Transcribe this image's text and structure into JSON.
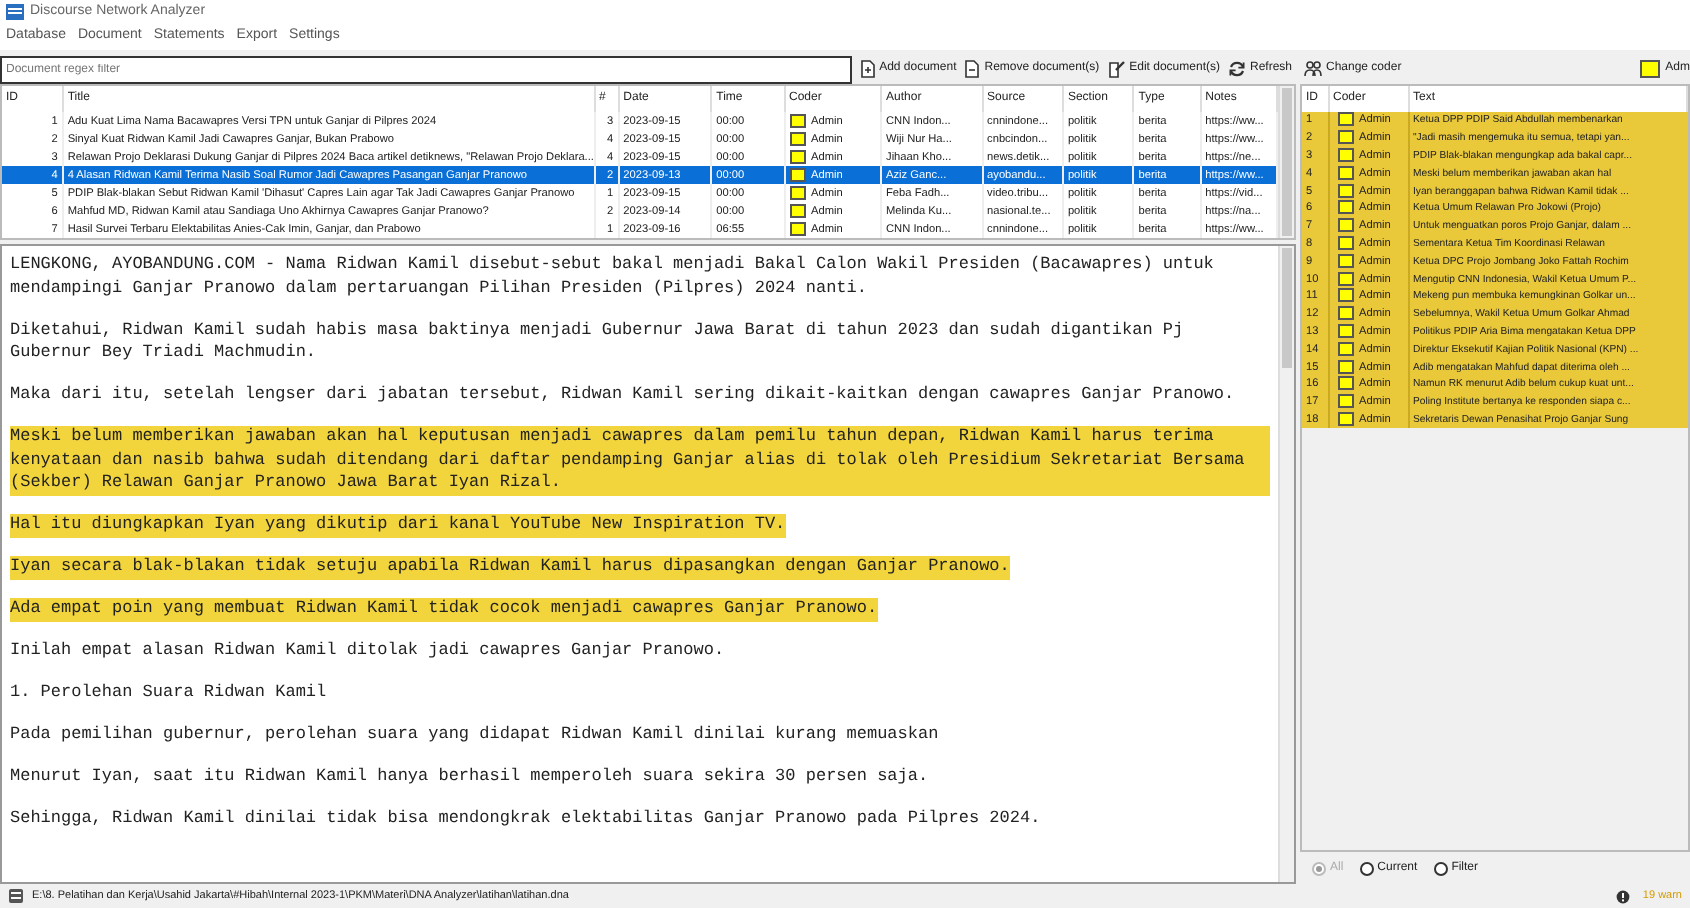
{
  "window": {
    "title": "Discourse Network Analyzer"
  },
  "menu": [
    "Database",
    "Document",
    "Statements",
    "Export",
    "Settings"
  ],
  "filter": {
    "placeholder": "Document regex filter"
  },
  "toolbar": [
    "Add document",
    "Remove document(s)",
    "Edit document(s)",
    "Refresh"
  ],
  "documents": {
    "columns": [
      "ID",
      "Title",
      "#",
      "Date",
      "Time",
      "Coder",
      "Author",
      "Source",
      "Section",
      "Type",
      "Notes"
    ],
    "rows": [
      {
        "id": "1",
        "title": "Adu Kuat Lima Nama Bacawapres Versi TPN untuk Ganjar di Pilpres 2024",
        "count": "3",
        "date": "2023-09-15",
        "time": "00:00",
        "coder": "Admin",
        "color": "#ffff00",
        "author": "CNN Indon...",
        "source": "cnnindone...",
        "section": "politik",
        "type": "berita",
        "notes": "https://ww...",
        "selected": false
      },
      {
        "id": "2",
        "title": "Sinyal Kuat Ridwan Kamil Jadi Cawapres Ganjar, Bukan Prabowo",
        "count": "4",
        "date": "2023-09-15",
        "time": "00:00",
        "coder": "Admin",
        "color": "#ffff00",
        "author": "Wiji Nur Ha...",
        "source": "cnbcindon...",
        "section": "politik",
        "type": "berita",
        "notes": "https://ww...",
        "selected": false
      },
      {
        "id": "3",
        "title": "Relawan Projo Deklarasi Dukung Ganjar di Pilpres 2024  Baca artikel detiknews, \"Relawan Projo Deklara...",
        "count": "4",
        "date": "2023-09-15",
        "time": "00:00",
        "coder": "Admin",
        "color": "#ffff00",
        "author": "Jihaan Kho...",
        "source": "news.detik...",
        "section": "politik",
        "type": "berita",
        "notes": "https://ne...",
        "selected": false
      },
      {
        "id": "4",
        "title": "4 Alasan Ridwan Kamil Terima Nasib Soal Rumor Jadi Cawapres Pasangan Ganjar Pranowo",
        "count": "2",
        "date": "2023-09-13",
        "time": "00:00",
        "coder": "Admin",
        "color": "#ffff00",
        "author": "Aziz Ganc...",
        "source": "ayobandu...",
        "section": "politik",
        "type": "berita",
        "notes": "https://ww...",
        "selected": true
      },
      {
        "id": "5",
        "title": "PDIP Blak-blakan Sebut Ridwan Kamil 'Dihasut' Capres Lain agar Tak Jadi Cawapres Ganjar Pranowo",
        "count": "1",
        "date": "2023-09-15",
        "time": "00:00",
        "coder": "Admin",
        "color": "#ffff00",
        "author": "Feba Fadh...",
        "source": "video.tribu...",
        "section": "politik",
        "type": "berita",
        "notes": "https://vid...",
        "selected": false
      },
      {
        "id": "6",
        "title": "Mahfud MD, Ridwan Kamil atau Sandiaga Uno Akhirnya Cawapres Ganjar Pranowo?",
        "count": "2",
        "date": "2023-09-14",
        "time": "00:00",
        "coder": "Admin",
        "color": "#ffff00",
        "author": "Melinda Ku...",
        "source": "nasional.te...",
        "section": "politik",
        "type": "berita",
        "notes": "https://na...",
        "selected": false
      },
      {
        "id": "7",
        "title": "Hasil Survei Terbaru Elektabilitas Anies-Cak Imin, Ganjar, dan Prabowo",
        "count": "1",
        "date": "2023-09-16",
        "time": "06:55",
        "coder": "Admin",
        "color": "#ffff00",
        "author": "CNN Indon...",
        "source": "cnnindone...",
        "section": "politik",
        "type": "berita",
        "notes": "https://ww...",
        "selected": false
      }
    ]
  },
  "document_text": [
    {
      "text": "LENGKONG, AYOBANDUNG.COM - Nama Ridwan Kamil disebut-sebut bakal menjadi Bakal Calon Wakil Presiden (Bacawapres) untuk mendampingi Ganjar Pranowo dalam pertaruangan Pilihan Presiden (Pilpres) 2024 nanti.",
      "highlighted": false
    },
    {
      "text": "Diketahui, Ridwan Kamil sudah habis masa baktinya menjadi Gubernur Jawa Barat di tahun 2023 dan sudah digantikan Pj Gubernur Bey Triadi Machmudin.",
      "highlighted": false
    },
    {
      "text": "Maka dari itu, setelah lengser dari jabatan tersebut, Ridwan Kamil sering dikait-kaitkan dengan cawapres Ganjar Pranowo.",
      "highlighted": false
    },
    {
      "text": "Meski belum memberikan jawaban akan hal keputusan menjadi cawapres dalam pemilu tahun depan, Ridwan Kamil harus terima kenyataan dan nasib bahwa sudah ditendang dari daftar pendamping Ganjar alias di tolak oleh Presidium Sekretariat Bersama (Sekber) Relawan Ganjar Pranowo Jawa Barat Iyan Rizal.",
      "highlighted": true
    },
    {
      "text": "Hal itu diungkapkan Iyan yang dikutip dari kanal YouTube New Inspiration TV.",
      "highlighted": true
    },
    {
      "text": "Iyan secara blak-blakan tidak setuju apabila Ridwan Kamil harus dipasangkan dengan Ganjar Pranowo.",
      "highlighted": true
    },
    {
      "text": "Ada empat poin yang membuat Ridwan Kamil tidak cocok menjadi cawapres Ganjar Pranowo.",
      "highlighted": true
    },
    {
      "text": "Inilah empat alasan Ridwan Kamil ditolak jadi cawapres Ganjar Pranowo.",
      "highlighted": false
    },
    {
      "text": "1. Perolehan Suara Ridwan Kamil",
      "highlighted": false
    },
    {
      "text": "Pada pemilihan gubernur, perolehan suara yang didapat Ridwan Kamil dinilai kurang memuaskan",
      "highlighted": false
    },
    {
      "text": "Menurut Iyan, saat itu Ridwan Kamil hanya berhasil memperoleh suara sekira 30 persen saja.",
      "highlighted": false
    },
    {
      "text": "Sehingga, Ridwan Kamil dinilai tidak bisa mendongkrak elektabilitas Ganjar Pranowo pada Pilpres 2024.",
      "highlighted": false
    }
  ],
  "statements_toolbar": {
    "button": "Change coder",
    "coder": "Adm",
    "color": "#ffff00"
  },
  "statements": {
    "columns": [
      "ID",
      "Coder",
      "Text"
    ],
    "rows": [
      {
        "id": "1",
        "coder": "Admin",
        "color": "#ffff00",
        "text": "Ketua DPP PDIP Said Abdullah membenarkan"
      },
      {
        "id": "2",
        "coder": "Admin",
        "color": "#ffff00",
        "text": "\"Jadi masih mengemuka itu semua, tetapi yan..."
      },
      {
        "id": "3",
        "coder": "Admin",
        "color": "#ffff00",
        "text": "PDIP Blak-blakan mengungkap ada bakal capr..."
      },
      {
        "id": "4",
        "coder": "Admin",
        "color": "#ffff00",
        "text": "Meski belum memberikan jawaban akan hal"
      },
      {
        "id": "5",
        "coder": "Admin",
        "color": "#ffff00",
        "text": "Iyan beranggapan bahwa Ridwan Kamil tidak ..."
      },
      {
        "id": "6",
        "coder": "Admin",
        "color": "#ffff00",
        "text": "Ketua Umum Relawan Pro Jokowi (Projo)"
      },
      {
        "id": "7",
        "coder": "Admin",
        "color": "#ffff00",
        "text": "Untuk menguatkan poros Projo Ganjar, dalam ..."
      },
      {
        "id": "8",
        "coder": "Admin",
        "color": "#ffff00",
        "text": "Sementara Ketua Tim Koordinasi Relawan"
      },
      {
        "id": "9",
        "coder": "Admin",
        "color": "#ffff00",
        "text": "Ketua DPC Projo Jombang Joko Fattah Rochim"
      },
      {
        "id": "10",
        "coder": "Admin",
        "color": "#ffff00",
        "text": "Mengutip CNN Indonesia, Wakil Ketua Umum P..."
      },
      {
        "id": "11",
        "coder": "Admin",
        "color": "#ffff00",
        "text": "Mekeng pun membuka kemungkinan Golkar un..."
      },
      {
        "id": "12",
        "coder": "Admin",
        "color": "#ffff00",
        "text": "Sebelumnya, Wakil Ketua Umum Golkar Ahmad"
      },
      {
        "id": "13",
        "coder": "Admin",
        "color": "#ffff00",
        "text": "Politikus PDIP Aria Bima mengatakan Ketua DPP"
      },
      {
        "id": "14",
        "coder": "Admin",
        "color": "#ffff00",
        "text": "Direktur Eksekutif Kajian Politik Nasional (KPN) ..."
      },
      {
        "id": "15",
        "coder": "Admin",
        "color": "#ffff00",
        "text": "Adib mengatakan Mahfud dapat diterima oleh ..."
      },
      {
        "id": "16",
        "coder": "Admin",
        "color": "#ffff00",
        "text": "Namun RK menurut Adib belum cukup kuat unt..."
      },
      {
        "id": "17",
        "coder": "Admin",
        "color": "#ffff00",
        "text": "Poling Institute bertanya ke responden siapa c..."
      },
      {
        "id": "18",
        "coder": "Admin",
        "color": "#ffff00",
        "text": "Sekretaris Dewan Penasihat Projo Ganjar Sung"
      }
    ]
  },
  "statement_filter": [
    {
      "label": "All",
      "selected": true,
      "disabled": true
    },
    {
      "label": "Current",
      "selected": false,
      "disabled": false
    },
    {
      "label": "Filter",
      "selected": false,
      "disabled": false
    }
  ],
  "status_bar": {
    "path": "E:\\8. Pelatihan dan Kerja\\Usahid Jakarta\\#Hibah\\Internal 2023-1\\PKM\\Materi\\DNA Analyzer\\latihan\\latihan.dna",
    "warnings": "19 warn"
  }
}
